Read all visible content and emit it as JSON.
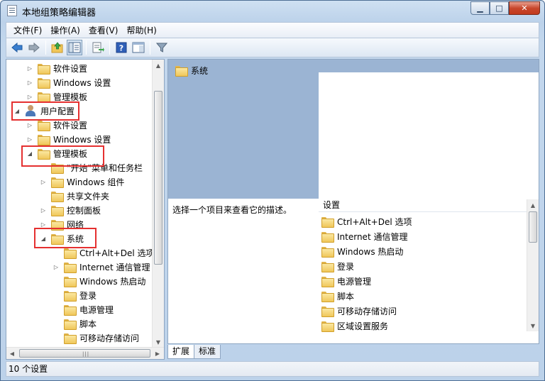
{
  "window": {
    "title": "本地组策略编辑器"
  },
  "menu": [
    "文件(F)",
    "操作(A)",
    "查看(V)",
    "帮助(H)"
  ],
  "toolbar": {
    "buttons": [
      "back-icon",
      "forward-icon",
      "up-folder-icon",
      "show-hide-tree-icon",
      "export-list-icon",
      "help-icon",
      "properties-pane-icon",
      "filter-icon"
    ]
  },
  "tree": [
    {
      "label": "软件设置",
      "expander": "▷",
      "icon": "folder"
    },
    {
      "label": "Windows 设置",
      "expander": "▷",
      "icon": "folder"
    },
    {
      "label": "管理模板",
      "expander": "▷",
      "icon": "folder"
    },
    {
      "label": "用户配置",
      "expander": "◢",
      "icon": "user"
    },
    {
      "label": "软件设置",
      "expander": "▷",
      "icon": "folder"
    },
    {
      "label": "Windows 设置",
      "expander": "▷",
      "icon": "folder"
    },
    {
      "label": "管理模板",
      "expander": "◢",
      "icon": "folder"
    },
    {
      "label": "\"开始\"菜单和任务栏",
      "expander": "",
      "icon": "folder"
    },
    {
      "label": "Windows 组件",
      "expander": "▷",
      "icon": "folder"
    },
    {
      "label": "共享文件夹",
      "expander": "",
      "icon": "folder"
    },
    {
      "label": "控制面板",
      "expander": "▷",
      "icon": "folder"
    },
    {
      "label": "网络",
      "expander": "▷",
      "icon": "folder"
    },
    {
      "label": "系统",
      "expander": "◢",
      "icon": "folder"
    },
    {
      "label": "Ctrl+Alt+Del 选项",
      "expander": "",
      "icon": "folder"
    },
    {
      "label": "Internet 通信管理",
      "expander": "▷",
      "icon": "folder"
    },
    {
      "label": "Windows 热启动",
      "expander": "",
      "icon": "folder"
    },
    {
      "label": "登录",
      "expander": "",
      "icon": "folder"
    },
    {
      "label": "电源管理",
      "expander": "",
      "icon": "folder"
    },
    {
      "label": "脚本",
      "expander": "",
      "icon": "folder"
    },
    {
      "label": "可移动存储访问",
      "expander": "",
      "icon": "folder"
    }
  ],
  "right": {
    "header_title": "系统",
    "description": "选择一个项目来查看它的描述。",
    "list_header": "设置",
    "items": [
      "Ctrl+Alt+Del 选项",
      "Internet 通信管理",
      "Windows 热启动",
      "登录",
      "电源管理",
      "脚本",
      "可移动存储访问",
      "区域设置服务"
    ]
  },
  "tabs": [
    "扩展",
    "标准"
  ],
  "status": "10 个设置",
  "colors": {
    "highlight_box": "#e53030",
    "header_band": "#9bb4d3",
    "folder": "#f0c75a"
  }
}
